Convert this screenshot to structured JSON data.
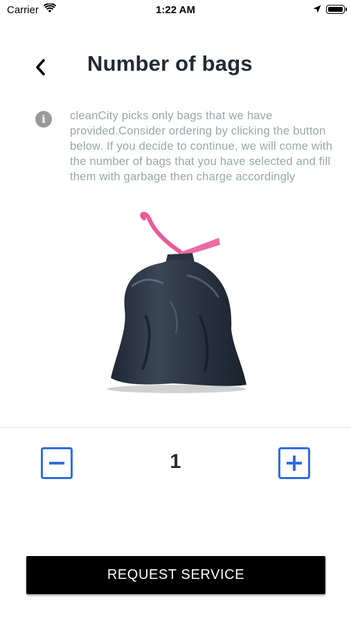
{
  "status_bar": {
    "carrier": "Carrier",
    "time": "1:22 AM",
    "icons": [
      "wifi-icon",
      "location-arrow-icon",
      "battery-icon"
    ]
  },
  "header": {
    "back_icon": "chevron-left-icon",
    "title": "Number of bags"
  },
  "info": {
    "icon": "info-icon",
    "text": "cleanCity picks only bags that we have provided.Consider ordering by clicking the button below. If you decide to continue, we will come with the number of bags that you have selected and fill them with garbage then charge accordingly"
  },
  "image": {
    "subject": "garbage-bag",
    "bag_color": "#2f3a4a",
    "tie_color": "#e85b98"
  },
  "stepper": {
    "minus_icon": "minus-square-icon",
    "plus_icon": "plus-square-icon",
    "count": "1",
    "accent_color": "#2f6de0"
  },
  "actions": {
    "request_label": "REQUEST SERVICE"
  }
}
